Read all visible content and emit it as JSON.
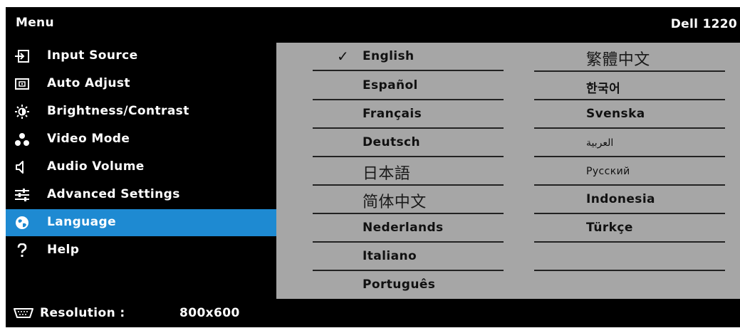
{
  "header": {
    "title": "Menu",
    "model": "Dell 1220"
  },
  "sidebar": {
    "items": [
      {
        "label": "Input Source",
        "icon": "input-source-icon"
      },
      {
        "label": "Auto Adjust",
        "icon": "auto-adjust-icon"
      },
      {
        "label": "Brightness/Contrast",
        "icon": "brightness-icon"
      },
      {
        "label": "Video Mode",
        "icon": "video-mode-icon"
      },
      {
        "label": "Audio Volume",
        "icon": "speaker-icon"
      },
      {
        "label": "Advanced Settings",
        "icon": "sliders-icon"
      },
      {
        "label": "Language",
        "icon": "globe-icon",
        "selected": true
      },
      {
        "label": "Help",
        "icon": "question-icon"
      }
    ]
  },
  "languages": {
    "column1": [
      {
        "label": "English",
        "selected": true
      },
      {
        "label": "Español"
      },
      {
        "label": "Français"
      },
      {
        "label": "Deutsch"
      },
      {
        "label": "日本語"
      },
      {
        "label": "简体中文"
      },
      {
        "label": "Nederlands"
      },
      {
        "label": "Italiano"
      },
      {
        "label": "Português"
      }
    ],
    "column2": [
      {
        "label": "繁體中文"
      },
      {
        "label": "한국어"
      },
      {
        "label": "Svenska"
      },
      {
        "label": "العربية"
      },
      {
        "label": "Русский"
      },
      {
        "label": "Indonesia"
      },
      {
        "label": "Türkçe"
      },
      {
        "label": ""
      }
    ],
    "selected_mark": "✓"
  },
  "footer": {
    "resolution_label": "Resolution :",
    "resolution_value": "800x600"
  },
  "colors": {
    "background": "#000000",
    "panel": "#a6a6a6",
    "highlight": "#1e8ad2",
    "text_light": "#ffffff",
    "text_dark": "#111111"
  }
}
